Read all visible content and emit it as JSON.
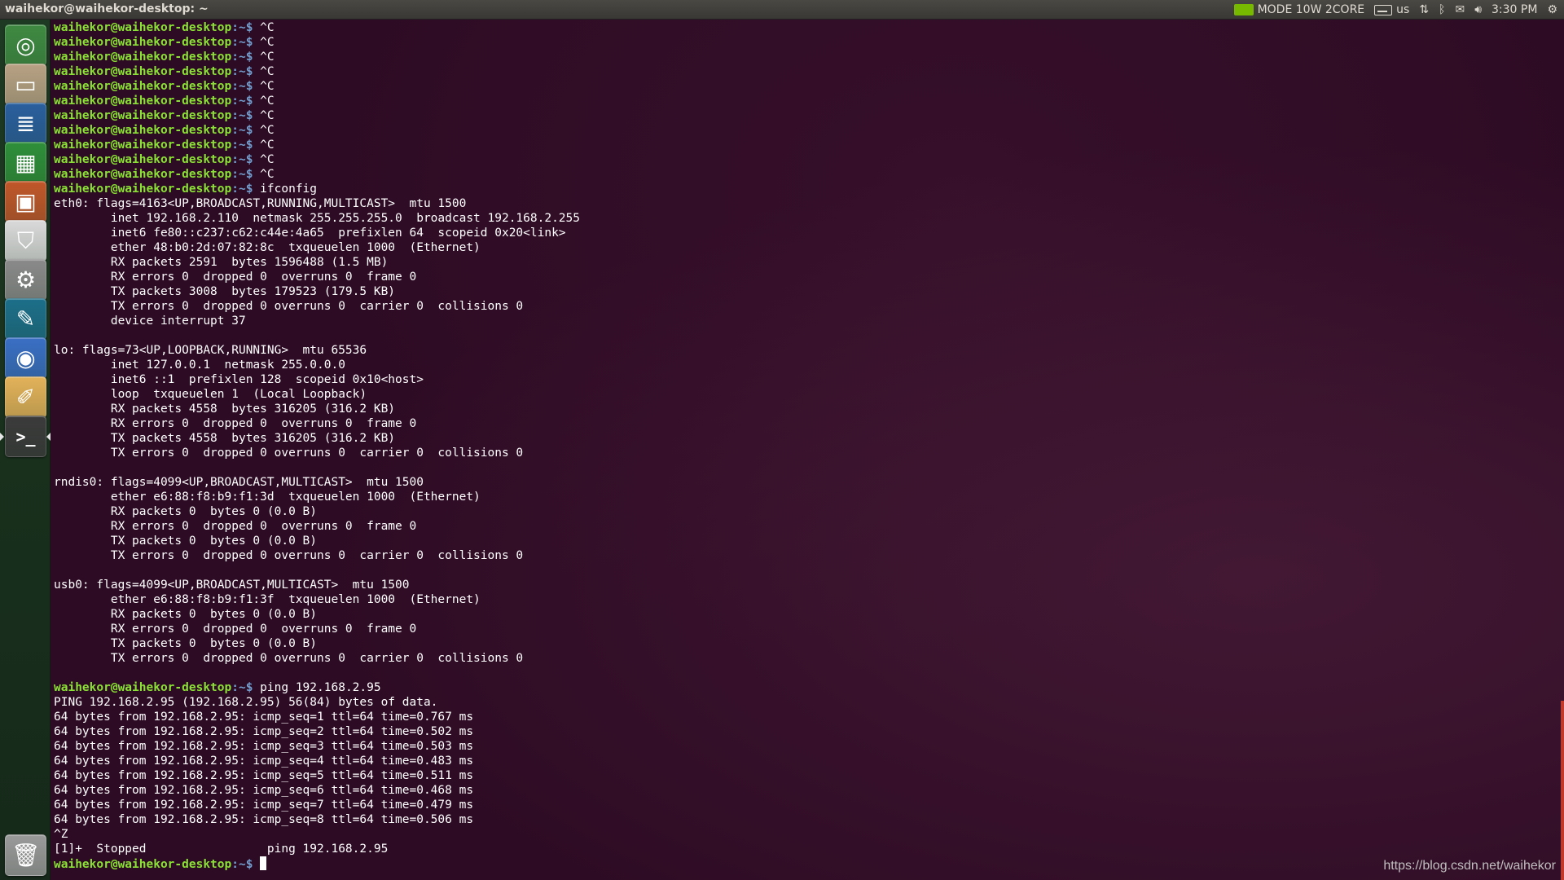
{
  "topbar": {
    "window_title": "waihekor@waihekor-desktop: ~",
    "power_mode": "MODE 10W 2CORE",
    "keyboard_layout": "us",
    "clock": "3:30 PM"
  },
  "launcher": {
    "items": [
      {
        "name": "ubuntu-dash",
        "icon": "dash-icon",
        "color": "#3f8a42"
      },
      {
        "name": "files",
        "icon": "file-manager-icon",
        "color": "#b8a184"
      },
      {
        "name": "writer",
        "icon": "libreoffice-writer-icon",
        "color": "#2a5f9e"
      },
      {
        "name": "calc",
        "icon": "libreoffice-calc-icon",
        "color": "#2f8f3a"
      },
      {
        "name": "impress",
        "icon": "libreoffice-impress-icon",
        "color": "#c0572a"
      },
      {
        "name": "software-center",
        "icon": "shopping-bag-icon",
        "color": "#d9d9d9"
      },
      {
        "name": "system-settings",
        "icon": "gear-wrench-icon",
        "color": "#8a8a8a"
      },
      {
        "name": "jetson-app",
        "icon": "pen-shield-icon",
        "color": "#1d6f8a"
      },
      {
        "name": "chromium",
        "icon": "chromium-icon",
        "color": "#3a6fc4"
      },
      {
        "name": "text-editor",
        "icon": "notepad-icon",
        "color": "#e3b25a"
      },
      {
        "name": "terminal",
        "icon": "terminal-icon",
        "color": "#3b3b3b"
      },
      {
        "name": "trash",
        "icon": "trash-icon",
        "color": "#9a9a9a"
      }
    ]
  },
  "terminal": {
    "prompt_user": "waihekor@waihekor-desktop",
    "prompt_path": ":~$",
    "lines": [
      {
        "p": true,
        "t": " ^C"
      },
      {
        "p": true,
        "t": " ^C"
      },
      {
        "p": true,
        "t": " ^C"
      },
      {
        "p": true,
        "t": " ^C"
      },
      {
        "p": true,
        "t": " ^C"
      },
      {
        "p": true,
        "t": " ^C"
      },
      {
        "p": true,
        "t": " ^C"
      },
      {
        "p": true,
        "t": " ^C"
      },
      {
        "p": true,
        "t": " ^C"
      },
      {
        "p": true,
        "t": " ^C"
      },
      {
        "p": true,
        "t": " ^C"
      },
      {
        "p": true,
        "t": " ifconfig"
      },
      {
        "p": false,
        "t": "eth0: flags=4163<UP,BROADCAST,RUNNING,MULTICAST>  mtu 1500"
      },
      {
        "p": false,
        "t": "        inet 192.168.2.110  netmask 255.255.255.0  broadcast 192.168.2.255"
      },
      {
        "p": false,
        "t": "        inet6 fe80::c237:c62:c44e:4a65  prefixlen 64  scopeid 0x20<link>"
      },
      {
        "p": false,
        "t": "        ether 48:b0:2d:07:82:8c  txqueuelen 1000  (Ethernet)"
      },
      {
        "p": false,
        "t": "        RX packets 2591  bytes 1596488 (1.5 MB)"
      },
      {
        "p": false,
        "t": "        RX errors 0  dropped 0  overruns 0  frame 0"
      },
      {
        "p": false,
        "t": "        TX packets 3008  bytes 179523 (179.5 KB)"
      },
      {
        "p": false,
        "t": "        TX errors 0  dropped 0 overruns 0  carrier 0  collisions 0"
      },
      {
        "p": false,
        "t": "        device interrupt 37"
      },
      {
        "p": false,
        "t": ""
      },
      {
        "p": false,
        "t": "lo: flags=73<UP,LOOPBACK,RUNNING>  mtu 65536"
      },
      {
        "p": false,
        "t": "        inet 127.0.0.1  netmask 255.0.0.0"
      },
      {
        "p": false,
        "t": "        inet6 ::1  prefixlen 128  scopeid 0x10<host>"
      },
      {
        "p": false,
        "t": "        loop  txqueuelen 1  (Local Loopback)"
      },
      {
        "p": false,
        "t": "        RX packets 4558  bytes 316205 (316.2 KB)"
      },
      {
        "p": false,
        "t": "        RX errors 0  dropped 0  overruns 0  frame 0"
      },
      {
        "p": false,
        "t": "        TX packets 4558  bytes 316205 (316.2 KB)"
      },
      {
        "p": false,
        "t": "        TX errors 0  dropped 0 overruns 0  carrier 0  collisions 0"
      },
      {
        "p": false,
        "t": ""
      },
      {
        "p": false,
        "t": "rndis0: flags=4099<UP,BROADCAST,MULTICAST>  mtu 1500"
      },
      {
        "p": false,
        "t": "        ether e6:88:f8:b9:f1:3d  txqueuelen 1000  (Ethernet)"
      },
      {
        "p": false,
        "t": "        RX packets 0  bytes 0 (0.0 B)"
      },
      {
        "p": false,
        "t": "        RX errors 0  dropped 0  overruns 0  frame 0"
      },
      {
        "p": false,
        "t": "        TX packets 0  bytes 0 (0.0 B)"
      },
      {
        "p": false,
        "t": "        TX errors 0  dropped 0 overruns 0  carrier 0  collisions 0"
      },
      {
        "p": false,
        "t": ""
      },
      {
        "p": false,
        "t": "usb0: flags=4099<UP,BROADCAST,MULTICAST>  mtu 1500"
      },
      {
        "p": false,
        "t": "        ether e6:88:f8:b9:f1:3f  txqueuelen 1000  (Ethernet)"
      },
      {
        "p": false,
        "t": "        RX packets 0  bytes 0 (0.0 B)"
      },
      {
        "p": false,
        "t": "        RX errors 0  dropped 0  overruns 0  frame 0"
      },
      {
        "p": false,
        "t": "        TX packets 0  bytes 0 (0.0 B)"
      },
      {
        "p": false,
        "t": "        TX errors 0  dropped 0 overruns 0  carrier 0  collisions 0"
      },
      {
        "p": false,
        "t": ""
      },
      {
        "p": true,
        "t": " ping 192.168.2.95"
      },
      {
        "p": false,
        "t": "PING 192.168.2.95 (192.168.2.95) 56(84) bytes of data."
      },
      {
        "p": false,
        "t": "64 bytes from 192.168.2.95: icmp_seq=1 ttl=64 time=0.767 ms"
      },
      {
        "p": false,
        "t": "64 bytes from 192.168.2.95: icmp_seq=2 ttl=64 time=0.502 ms"
      },
      {
        "p": false,
        "t": "64 bytes from 192.168.2.95: icmp_seq=3 ttl=64 time=0.503 ms"
      },
      {
        "p": false,
        "t": "64 bytes from 192.168.2.95: icmp_seq=4 ttl=64 time=0.483 ms"
      },
      {
        "p": false,
        "t": "64 bytes from 192.168.2.95: icmp_seq=5 ttl=64 time=0.511 ms"
      },
      {
        "p": false,
        "t": "64 bytes from 192.168.2.95: icmp_seq=6 ttl=64 time=0.468 ms"
      },
      {
        "p": false,
        "t": "64 bytes from 192.168.2.95: icmp_seq=7 ttl=64 time=0.479 ms"
      },
      {
        "p": false,
        "t": "64 bytes from 192.168.2.95: icmp_seq=8 ttl=64 time=0.506 ms"
      },
      {
        "p": false,
        "t": "^Z"
      },
      {
        "p": false,
        "t": "[1]+  Stopped                 ping 192.168.2.95"
      },
      {
        "p": true,
        "t": " ",
        "cursor": true
      }
    ]
  },
  "watermark": "https://blog.csdn.net/waihekor",
  "colors": {
    "prompt_user": "#8ae234",
    "prompt_path": "#729fcf",
    "terminal_bg": "#2e0b24",
    "text": "#ffffff"
  }
}
